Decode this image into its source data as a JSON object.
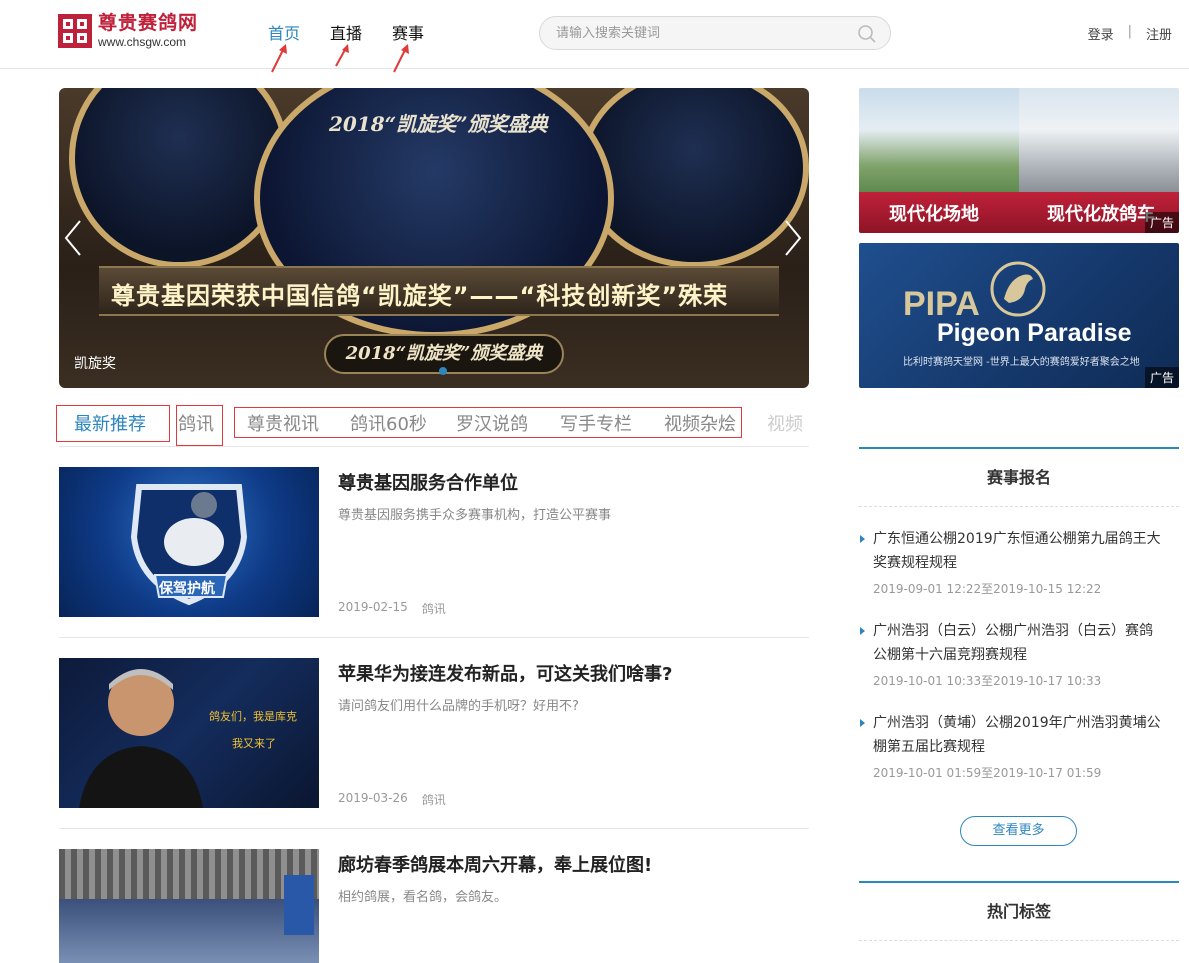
{
  "header": {
    "logo_cn": "尊贵赛鸽网",
    "logo_en": "www.chsgw.com",
    "nav": [
      "首页",
      "直播",
      "赛事"
    ],
    "search_placeholder": "请输入搜索关键词",
    "login": "登录",
    "sep": "|",
    "register": "注册"
  },
  "banner": {
    "award_small": "2018“凯旋奖”颁奖盛典",
    "headline": "尊贵基因荣获中国信鸽“凯旋奖”——“科技创新奖”殊荣",
    "sub": "2018“凯旋奖”颁奖盛典",
    "caption": "凯旋奖"
  },
  "tabs": [
    "最新推荐",
    "鸽讯",
    "尊贵视讯",
    "鸽讯60秒",
    "罗汉说鸽",
    "写手专栏",
    "视频杂烩",
    "视频"
  ],
  "articles": [
    {
      "title": "尊贵基因服务合作单位",
      "desc": "尊贵基因服务携手众多赛事机构，打造公平赛事",
      "date": "2019-02-15",
      "category": "鸽讯",
      "thumb_text": "保驾护航"
    },
    {
      "title": "苹果华为接连发布新品，可这关我们啥事?",
      "desc": "请问鸽友们用什么品牌的手机呀？好用不?",
      "date": "2019-03-26",
      "category": "鸽讯",
      "thumb_text_1": "鸽友们，我是库克",
      "thumb_text_2": "我又来了"
    },
    {
      "title": "廊坊春季鸽展本周六开幕，奉上展位图!",
      "desc": "相约鸽展，看名鸽，会鸽友。"
    }
  ],
  "ads": {
    "ad1_left": "现代化场地",
    "ad1_right": "现代化放鸽车",
    "ad2_big": "PIPA",
    "ad2_title": "Pigeon Paradise",
    "ad2_sub": "比利时赛鸽天堂网 -世界上最大的赛鸽爱好者聚会之地",
    "label": "广告"
  },
  "sidebar": {
    "race_heading": "赛事报名",
    "races": [
      {
        "title": "广东恒通公棚2019广东恒通公棚第九届鸽王大奖赛规程规程",
        "date": "2019-09-01 12:22至2019-10-15 12:22"
      },
      {
        "title": "广州浩羽（白云）公棚广州浩羽（白云）赛鸽公棚第十六届竞翔赛规程",
        "date": "2019-10-01 10:33至2019-10-17 10:33"
      },
      {
        "title": "广州浩羽（黄埔）公棚2019年广州浩羽黄埔公棚第五届比赛规程",
        "date": "2019-10-01 01:59至2019-10-17 01:59"
      }
    ],
    "more": "查看更多",
    "tags_heading": "热门标签"
  },
  "colors": {
    "accent": "#2c86c0",
    "brand": "#c0213a",
    "annotation": "#e03b3b"
  }
}
